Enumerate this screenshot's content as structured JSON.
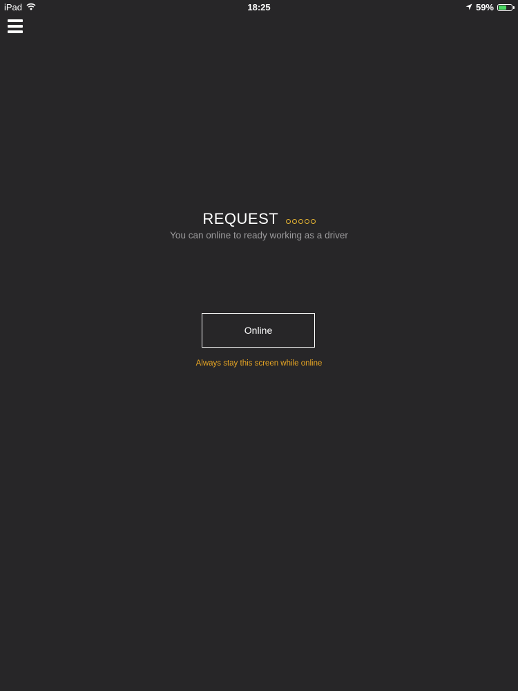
{
  "status_bar": {
    "device": "iPad",
    "time": "18:25",
    "battery": "59%",
    "battery_level": 0.59,
    "icons": [
      "wifi-icon",
      "location-arrow-icon",
      "battery-icon"
    ]
  },
  "header": {
    "menu_icon": "hamburger-menu-icon"
  },
  "main": {
    "title": "REQUEST",
    "subtitle": "You can online to ready working as a driver",
    "online_button": "Online",
    "hint": "Always stay this screen while online"
  },
  "colors": {
    "background": "#272628",
    "accent": "#e8a624",
    "dots": "#e8b633",
    "battery": "#4cd964"
  }
}
